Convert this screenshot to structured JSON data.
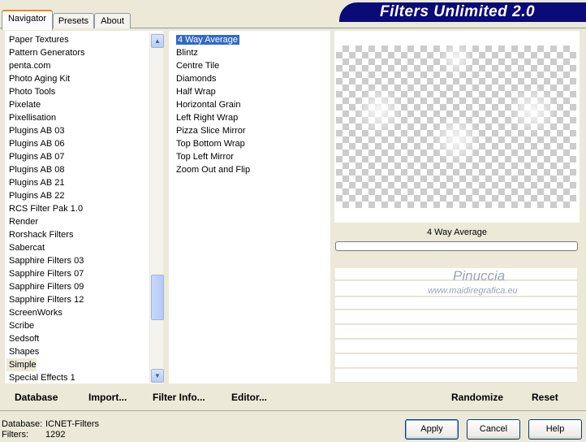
{
  "tabs": [
    {
      "label": "Navigator"
    },
    {
      "label": "Presets"
    },
    {
      "label": "About"
    }
  ],
  "app_title": "Filters Unlimited 2.0",
  "categories": [
    "Paper Textures",
    "Pattern Generators",
    "penta.com",
    "Photo Aging Kit",
    "Photo Tools",
    "Pixelate",
    "Pixellisation",
    "Plugins AB 03",
    "Plugins AB 06",
    "Plugins AB 07",
    "Plugins AB 08",
    "Plugins AB 21",
    "Plugins AB 22",
    "RCS Filter Pak 1.0",
    "Render",
    "Rorshack Filters",
    "Sabercat",
    "Sapphire Filters 03",
    "Sapphire Filters 07",
    "Sapphire Filters 09",
    "Sapphire Filters 12",
    "ScreenWorks",
    "Scribe",
    "Sedsoft",
    "Shapes",
    "Simple",
    "Special Effects 1"
  ],
  "selected_category": "Simple",
  "filters": [
    "4 Way Average",
    "Blintz",
    "Centre Tile",
    "Diamonds",
    "Half Wrap",
    "Horizontal Grain",
    "Left Right Wrap",
    "Pizza Slice Mirror",
    "Top Bottom Wrap",
    "Top Left Mirror",
    "Zoom Out and Flip"
  ],
  "selected_filter": "4 Way Average",
  "preview_filter_name": "4 Way Average",
  "watermark": {
    "name": "Pinuccia",
    "url": "www.maidiregrafica.eu"
  },
  "nav_links": {
    "database": "Database",
    "import": "Import...",
    "filter_info": "Filter Info...",
    "editor": "Editor..."
  },
  "preview_links": {
    "randomize": "Randomize",
    "reset": "Reset"
  },
  "footer": {
    "database_label": "Database:",
    "database_value": "ICNET-Filters",
    "filters_label": "Filters:",
    "filters_value": "1292"
  },
  "buttons": {
    "apply": "Apply",
    "cancel": "Cancel",
    "help": "Help"
  },
  "colors": {
    "selection": "#316AC5",
    "banner": "#0A0A78",
    "dialog_bg": "#ECE9D8"
  }
}
